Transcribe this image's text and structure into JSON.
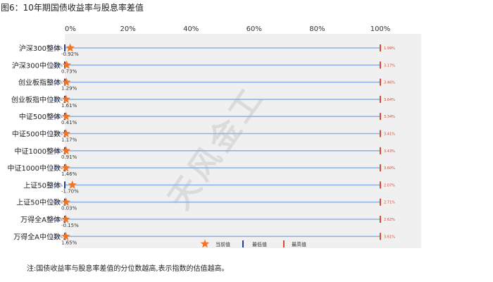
{
  "figure_title": "图6：10年期国债收益率与股息率差值",
  "footnote": "注:国债收益率与股息率差值的分位数越高,表示指数的估值越高。",
  "watermark": "天风金工",
  "colors": {
    "plot_bg": "#f0f0f0",
    "range_line": "#8fb4e3",
    "current_marker": "#f4731f",
    "min_marker": "#1f3f93",
    "max_marker": "#e0462e",
    "min_text": "#1f3f93",
    "max_text": "#e0462e"
  },
  "chart_data": {
    "type": "range_dot",
    "xlim": [
      0,
      100
    ],
    "xticks": [
      "0%",
      "20%",
      "40%",
      "60%",
      "80%",
      "100%"
    ],
    "xtick_values": [
      0,
      20,
      40,
      60,
      80,
      100
    ],
    "current_percentile_estimates": [
      1.7,
      0.6,
      0.5,
      0.4,
      0.4,
      0.4,
      0.4,
      0.3,
      2.4,
      0.4,
      0.3,
      0.3
    ],
    "min_percentile": 0,
    "max_percentile": 100,
    "legend": {
      "current": "当前值",
      "min": "最低值",
      "max": "最高值"
    },
    "categories": [
      "沪深300整体",
      "沪深300中位数",
      "创业板指整体",
      "创业板指中位数",
      "中证500整体",
      "中证500中位数",
      "中证1000整体",
      "中证1000中位数",
      "上证50整体",
      "上证50中位数",
      "万得全A整体",
      "万得全A中位数"
    ],
    "min_values": [
      "-1.13%",
      "0.62%",
      "1.27%",
      "1.61%",
      "0.24%",
      "1.10%",
      "0.84%",
      "1.43%",
      "-1.90%",
      "-0.00%",
      "-0.32%",
      "1.65%"
    ],
    "current_values": [
      "-0.92%",
      "0.73%",
      "1.29%",
      "1.61%",
      "0.41%",
      "1.17%",
      "0.91%",
      "1.46%",
      "-1.70%",
      "0.03%",
      "-0.15%",
      "1.65%"
    ],
    "max_values": [
      "1.99%",
      "3.17%",
      "3.46%",
      "3.64%",
      "3.34%",
      "3.41%",
      "3.43%",
      "3.60%",
      "2.07%",
      "2.71%",
      "2.62%",
      "3.61%"
    ]
  }
}
